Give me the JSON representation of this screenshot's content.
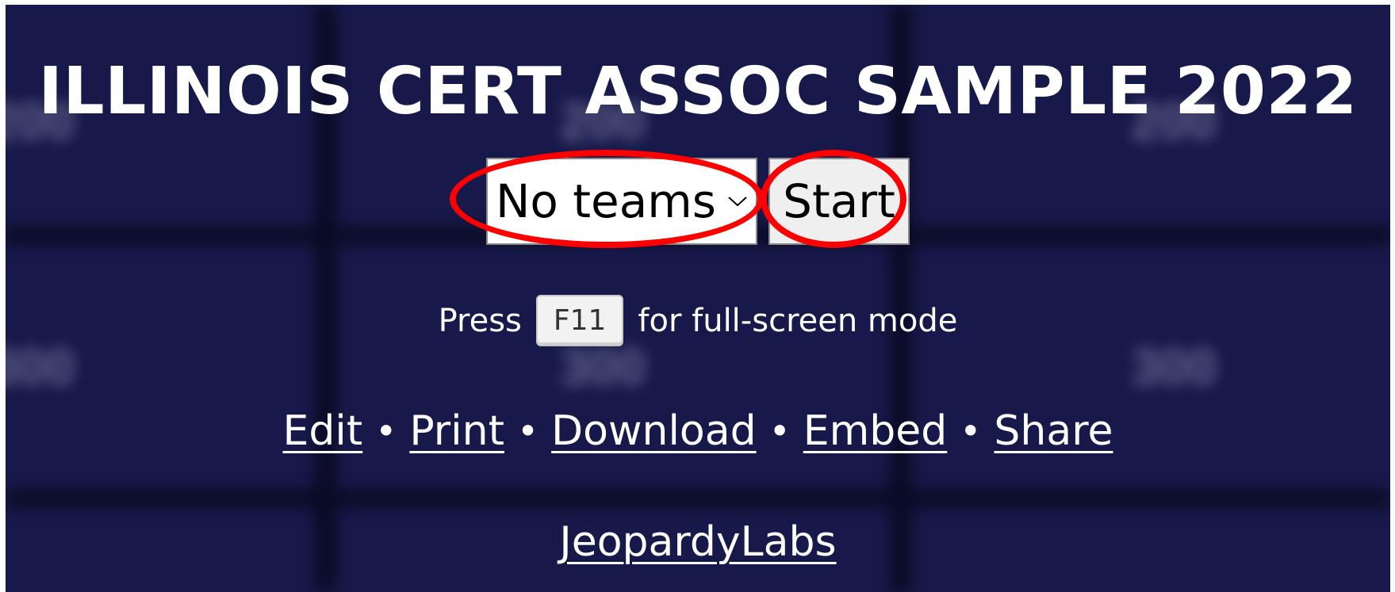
{
  "title": "ILLINOIS CERT ASSOC SAMPLE 2022",
  "controls": {
    "team_select_value": "No teams",
    "start_label": "Start"
  },
  "hint": {
    "prefix": "Press",
    "key": "F11",
    "suffix": "for full-screen mode"
  },
  "links": {
    "edit": "Edit",
    "print": "Print",
    "download": "Download",
    "embed": "Embed",
    "share": "Share",
    "separator": "•"
  },
  "brand": "JeopardyLabs",
  "colors": {
    "background": "#17194a",
    "annotation_ring": "#ff0000"
  },
  "icons": {
    "select_arrow": "chevron-down-icon"
  }
}
